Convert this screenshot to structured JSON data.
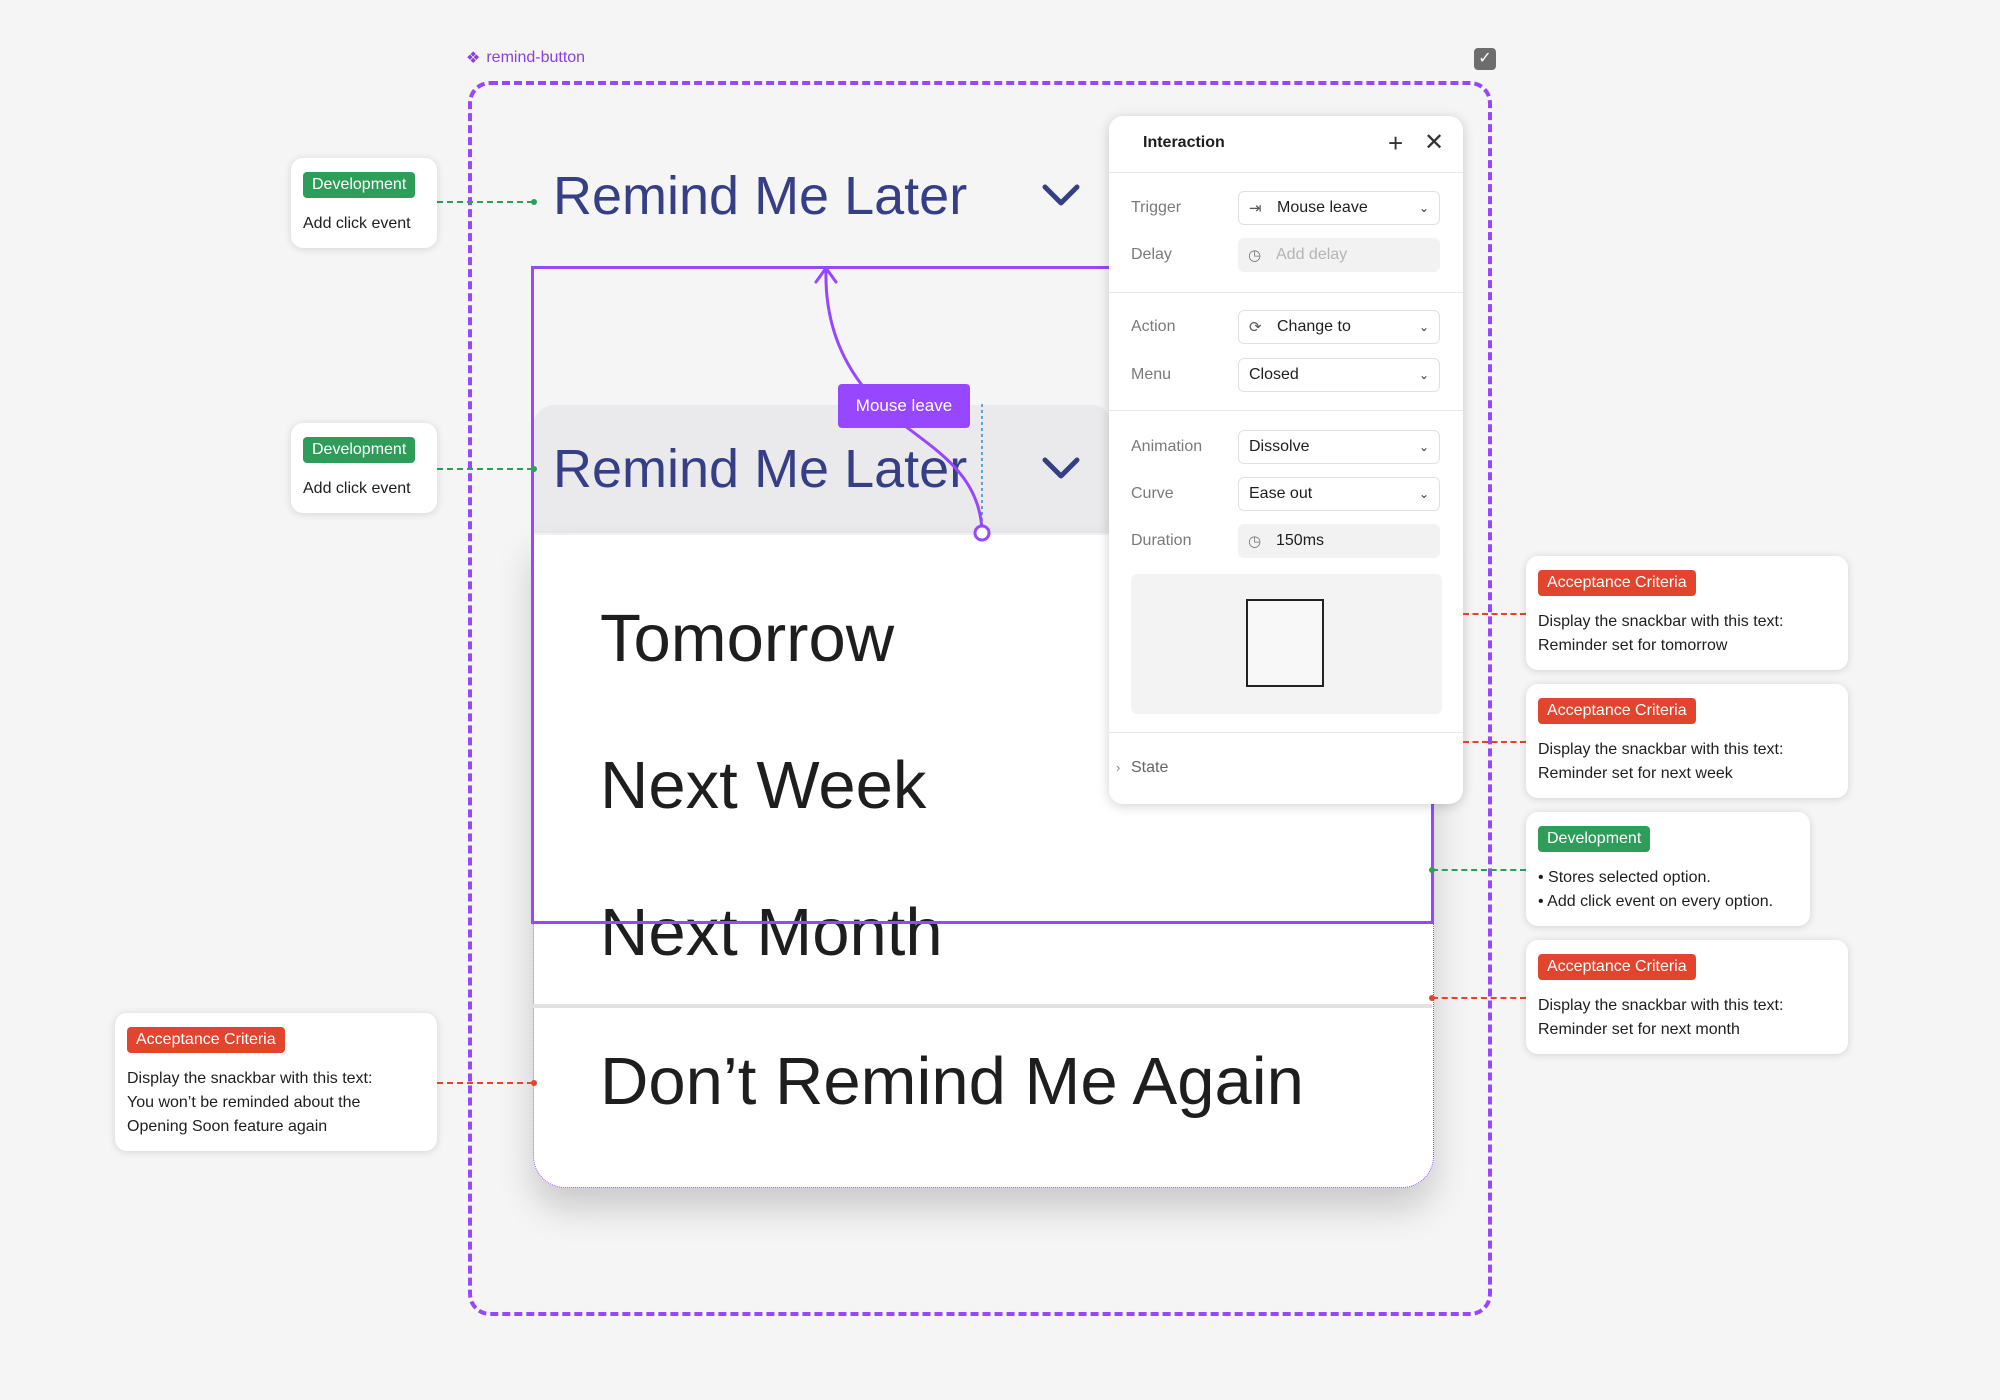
{
  "frame": {
    "label": "remind-button",
    "check_icon": "check-icon",
    "accent": "#9747ff"
  },
  "remind_button": {
    "label": "Remind Me Later",
    "chevron_icon": "chevron-down-icon",
    "color": "#363f85"
  },
  "menu": {
    "items": [
      "Tomorrow",
      "Next Week",
      "Next Month",
      "Don’t Remind Me Again"
    ]
  },
  "interaction_tag": "Mouse leave",
  "panel": {
    "title": "Interaction",
    "add_icon": "plus-icon",
    "close_icon": "close-icon",
    "trigger": {
      "label": "Trigger",
      "value": "Mouse leave"
    },
    "delay": {
      "label": "Delay",
      "placeholder": "Add delay"
    },
    "action": {
      "label": "Action",
      "value": "Change to"
    },
    "menu": {
      "label": "Menu",
      "value": "Closed"
    },
    "animation": {
      "label": "Animation",
      "value": "Dissolve"
    },
    "curve": {
      "label": "Curve",
      "value": "Ease out"
    },
    "duration": {
      "label": "Duration",
      "value": "150ms"
    },
    "state": {
      "label": "State"
    }
  },
  "annotations": {
    "dev_1": {
      "badge": "Development",
      "text": "Add click event"
    },
    "dev_2": {
      "badge": "Development",
      "text": "Add click event"
    },
    "ac_tomorrow": {
      "badge": "Acceptance Criteria",
      "line1": "Display the snackbar with this text:",
      "line2": "Reminder set for tomorrow"
    },
    "ac_next_week": {
      "badge": "Acceptance Criteria",
      "line1": "Display the snackbar with this text:",
      "line2": "Reminder set for next week"
    },
    "dev_options": {
      "badge": "Development",
      "line1": "• Stores selected option.",
      "line2": "• Add click event on every option."
    },
    "ac_next_month": {
      "badge": "Acceptance Criteria",
      "line1": "Display the snackbar with this text:",
      "line2": "Reminder set for next month"
    },
    "ac_dont_remind": {
      "badge": "Acceptance Criteria",
      "line1": "Display the snackbar with this text:",
      "line2": "You won’t be reminded about the",
      "line3": "Opening Soon feature again"
    }
  },
  "colors": {
    "development": "#2f9d5a",
    "acceptance": "#e2452d"
  }
}
